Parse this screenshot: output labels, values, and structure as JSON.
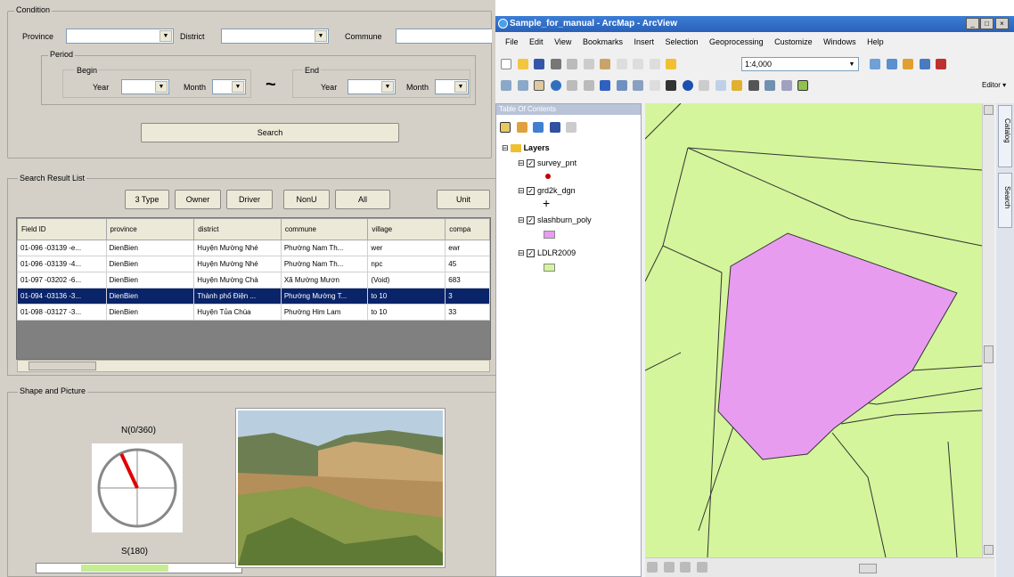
{
  "left": {
    "condition_label": "Condition",
    "province_label": "Province",
    "district_label": "District",
    "commune_label": "Commune",
    "period_label": "Period",
    "begin_label": "Begin",
    "end_label": "End",
    "year_label": "Year",
    "month_label": "Month",
    "tilde": "~",
    "search_button": "Search",
    "result_label": "Search Result List",
    "filter_buttons": [
      "3 Type",
      "Owner",
      "Driver",
      "NonU",
      "All",
      "Unit"
    ],
    "columns": [
      "Field ID",
      "province",
      "district",
      "commune",
      "village",
      "compa"
    ],
    "rows": [
      [
        "01-096 -03139 -e...",
        "DienBien",
        "Huyện Mường Nhé",
        "Phường Nam Th...",
        "wer",
        "ewr"
      ],
      [
        "01-096 -03139 -4...",
        "DienBien",
        "Huyện Mường Nhé",
        "Phường Nam Th...",
        "npc",
        "45"
      ],
      [
        "01-097 -03202 -6...",
        "DienBien",
        "Huyện Mường Chà",
        "Xã Mường Mươn",
        "(Void)",
        "683"
      ],
      [
        "01-094 -03136 -3...",
        "DienBien",
        "Thành phố Điện ...",
        "Phường Mường T...",
        "to 10",
        "3"
      ],
      [
        "01-098 -03127 -3...",
        "DienBien",
        "Huyện Tủa Chùa",
        "Phường Him Lam",
        "to 10",
        "33"
      ]
    ],
    "selected_row": 3,
    "shape_label": "Shape and Picture",
    "compass_north": "N(0/360)",
    "compass_south": "S(180)",
    "compass_angle_deg": -25
  },
  "arcmap": {
    "title": "Sample_for_manual - ArcMap - ArcView",
    "menu": [
      "File",
      "Edit",
      "View",
      "Bookmarks",
      "Insert",
      "Selection",
      "Geoprocessing",
      "Customize",
      "Windows",
      "Help"
    ],
    "scale": "1:4,000",
    "editor_label": "Editor ▾",
    "toc_title": "Table Of Contents",
    "layers_label": "Layers",
    "layers": [
      "survey_pnt",
      "grd2k_dgn",
      "slashburn_poly",
      "LDLR2009"
    ],
    "side_tabs": [
      "Catalog",
      "Search"
    ],
    "colors": {
      "map_fill": "#d4f59c",
      "polygon_fill": "#e89cf0",
      "point": "#c00000",
      "selection": "#0a246a"
    }
  }
}
